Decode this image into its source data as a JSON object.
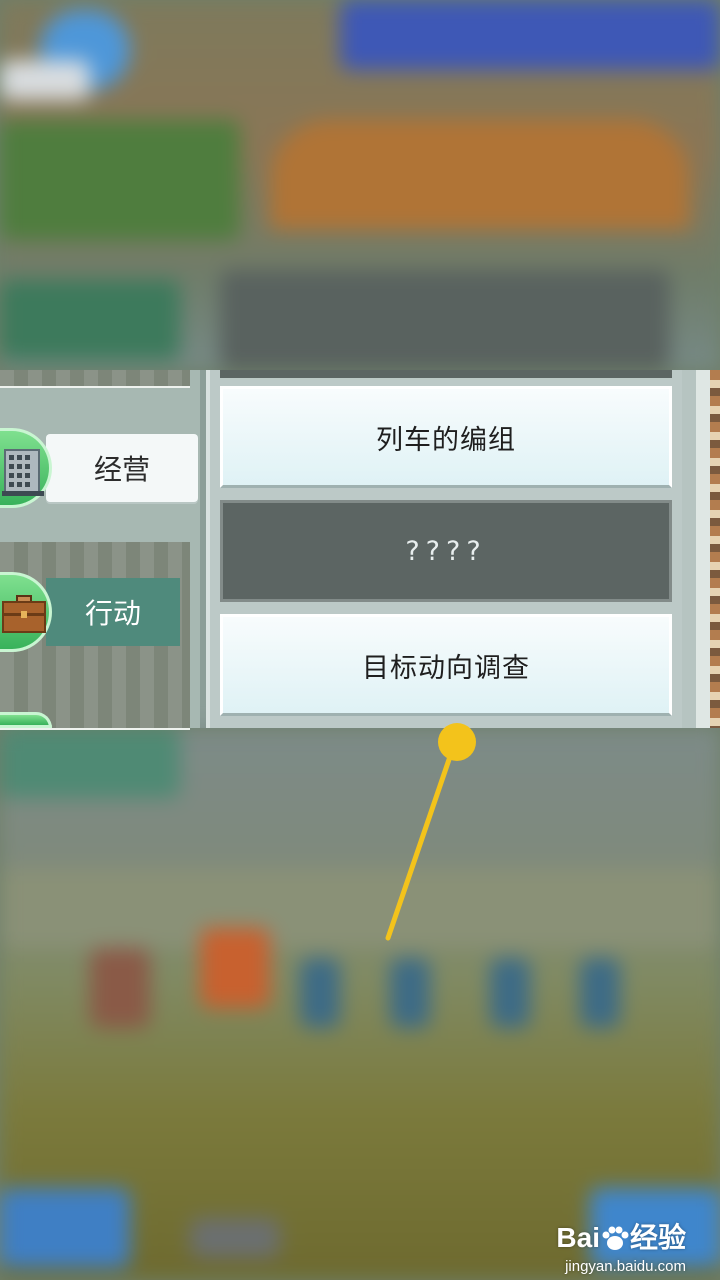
{
  "left_menu": {
    "items": [
      {
        "label": "经营",
        "icon": "building-icon"
      },
      {
        "label": "行动",
        "icon": "briefcase-icon"
      }
    ]
  },
  "options": [
    {
      "label": "列车的编组",
      "state": "enabled"
    },
    {
      "label": "????",
      "state": "locked"
    },
    {
      "label": "目标动向调查",
      "state": "enabled"
    }
  ],
  "annotation": {
    "color": "#f3c31b"
  },
  "watermark": {
    "brand_prefix": "Bai",
    "brand_suffix": "经验",
    "url": "jingyan.baidu.com"
  }
}
